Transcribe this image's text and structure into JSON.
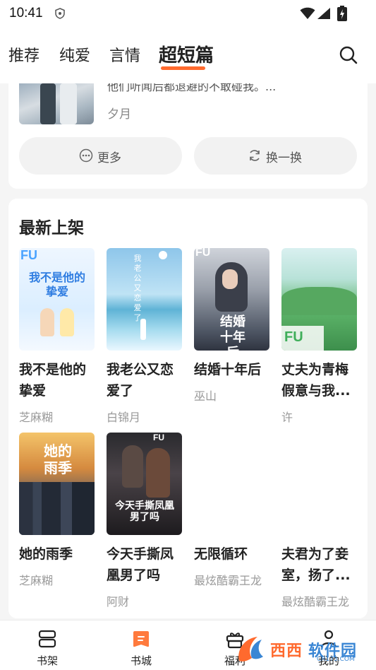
{
  "status_bar": {
    "time": "10:41"
  },
  "top_tabs": [
    {
      "label": "推荐"
    },
    {
      "label": "纯爱"
    },
    {
      "label": "言情"
    },
    {
      "label": "超短篇",
      "active": true
    }
  ],
  "accent_color": "#ff6a2e",
  "featured": {
    "description": "他们听闻后都退避的不敢碰我。...",
    "author": "夕月",
    "more_label": "更多",
    "refresh_label": "换一换"
  },
  "new_arrivals": {
    "title": "最新上架",
    "books": [
      {
        "title": "我不是他的挚爱",
        "author": "芝麻糊",
        "cover_text": "我不是他的挚爱",
        "cover_brand": "FU"
      },
      {
        "title": "我老公又恋爱了",
        "author": "白锦月",
        "cover_text": "我老公又恋爱了"
      },
      {
        "title": "结婚十年后",
        "author": "巫山",
        "cover_text": "结婚十年后",
        "cover_brand": "FU"
      },
      {
        "title": "丈夫为青梅假意与我...",
        "author": "许",
        "cover_brand": "FU"
      },
      {
        "title": "她的雨季",
        "author": "芝麻糊",
        "cover_text": "她的雨季"
      },
      {
        "title": "今天手撕凤凰男了吗",
        "author": "阿财",
        "cover_text": "今天手撕凤凰男了吗",
        "cover_brand": "FU"
      },
      {
        "title": "无限循环",
        "author": "最炫酷霸王龙"
      },
      {
        "title": "夫君为了妾室，扬了...",
        "author": "最炫酷霸王龙"
      }
    ]
  },
  "bottom_nav": [
    {
      "label": "书架",
      "icon": "bookshelf-icon"
    },
    {
      "label": "书城",
      "icon": "bookstore-icon",
      "active": true
    },
    {
      "label": "福利",
      "icon": "gift-icon"
    },
    {
      "label": "我的",
      "icon": "profile-icon"
    }
  ],
  "watermark": {
    "part1": "西西",
    "part2": "软件园",
    "url": "CR173.COM"
  }
}
